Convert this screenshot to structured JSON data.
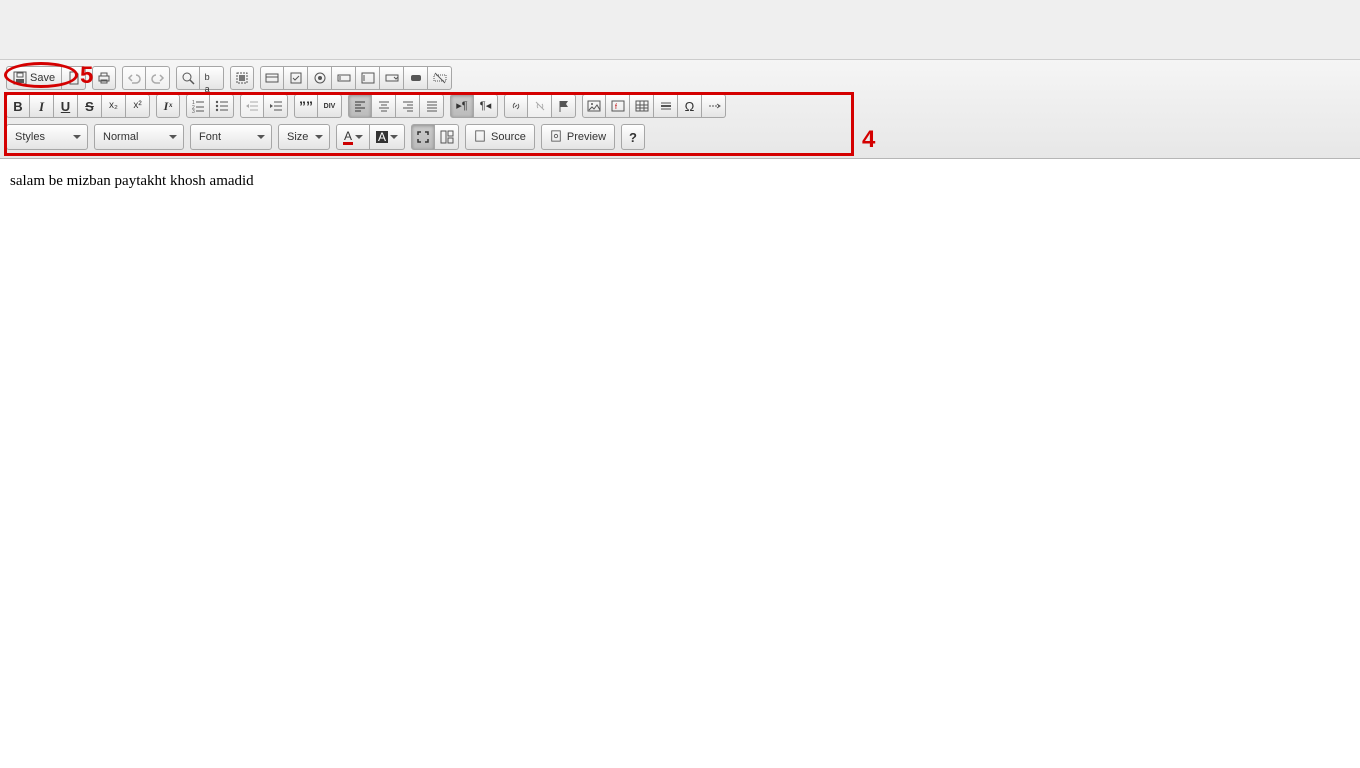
{
  "toolbar": {
    "save_label": "Save",
    "styles_label": "Styles",
    "format_label": "Normal",
    "font_label": "Font",
    "size_label": "Size",
    "source_label": "Source",
    "preview_label": "Preview",
    "text_color_letter": "A",
    "bg_color_letter": "A",
    "div_label": "DIV"
  },
  "glyphs": {
    "bold": "B",
    "italic": "I",
    "underline": "U",
    "strike": "S",
    "subscript": "x₂",
    "superscript": "x²",
    "remove_format": "Iˣ",
    "quote": "””",
    "omega": "Ω",
    "anchor": "↳",
    "question": "?",
    "pilcrow_ltr": "¶",
    "pilcrow_rtl": "¶"
  },
  "content": {
    "body_text": "salam be mizban paytakht khosh amadid"
  },
  "annotations": {
    "label4": "4",
    "label5": "5"
  }
}
